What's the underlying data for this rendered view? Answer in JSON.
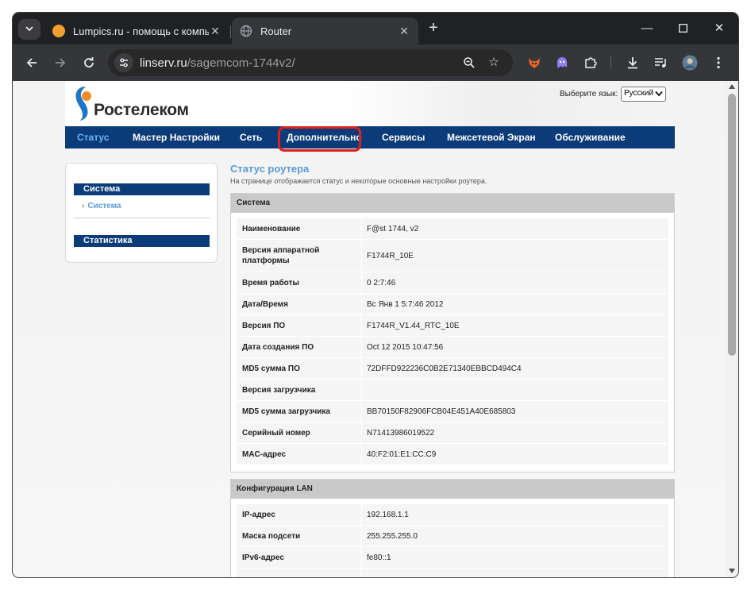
{
  "browser": {
    "tabs": [
      {
        "title": "Lumpics.ru - помощь с компь",
        "active": false,
        "favicon_color": "#f0a030"
      },
      {
        "title": "Router",
        "active": true,
        "favicon_color": "#9aa0a6"
      }
    ],
    "address": {
      "host": "linserv.ru",
      "path": "/sagemcom-1744v2/"
    },
    "icons": {
      "tab_search": "chevron-down-icon",
      "new_tab": "plus-icon",
      "back": "arrow-left-icon",
      "forward": "arrow-right-icon",
      "reload": "reload-icon",
      "site_info": "tune-icon",
      "zoom": "zoom-icon",
      "bookmark": "star-icon",
      "downloads": "download-icon",
      "media": "media-queue-icon",
      "menu": "kebab-menu-icon"
    }
  },
  "router_page": {
    "brand": {
      "name": "Ростелеком",
      "colors": {
        "blue": "#1d75c9",
        "orange": "#f28c28"
      }
    },
    "language": {
      "label": "Выберите язык:",
      "selected": "Русский"
    },
    "nav": [
      {
        "label": "Статус",
        "current": true
      },
      {
        "label": "Мастер Настройки",
        "current": false
      },
      {
        "label": "Сеть",
        "current": false
      },
      {
        "label": "Дополнительно",
        "current": false,
        "highlighted": true
      },
      {
        "label": "Сервисы",
        "current": false
      },
      {
        "label": "Межсетевой Экран",
        "current": false
      },
      {
        "label": "Обслуживание",
        "current": false
      }
    ],
    "sidebar": {
      "groups": [
        {
          "title": "Система",
          "items": [
            "Система"
          ]
        },
        {
          "title": "Статистика",
          "items": []
        }
      ]
    },
    "content": {
      "title": "Статус роутера",
      "description": "На странице отображается статус и некоторые основные настройки роутера.",
      "sections": [
        {
          "title": "Система",
          "rows": [
            {
              "key": "Наименование",
              "value": "F@st 1744, v2"
            },
            {
              "key": "Версия аппаратной платформы",
              "value": "F1744R_10E"
            },
            {
              "key": "Время работы",
              "value": "0 2:7:46"
            },
            {
              "key": "Дата/Время",
              "value": "Вс Янв 1 5:7:46 2012"
            },
            {
              "key": "Версия ПО",
              "value": "F1744R_V1.44_RTC_10E"
            },
            {
              "key": "Дата создания ПО",
              "value": "Oct 12 2015 10:47:56"
            },
            {
              "key": "MD5 сумма ПО",
              "value": "72DFFD922236C0B2E71340EBBCD494C4"
            },
            {
              "key": "Версия загрузчика",
              "value": ""
            },
            {
              "key": "MD5 сумма загрузчика",
              "value": "BB70150F82906FCB04E451A40E685803"
            },
            {
              "key": "Серийный номер",
              "value": "N71413986019522"
            },
            {
              "key": "MAC-адрес",
              "value": "40:F2:01:E1:CC:C9"
            }
          ]
        },
        {
          "title": "Конфигурация LAN",
          "rows": [
            {
              "key": "IP-адрес",
              "value": "192.168.1.1"
            },
            {
              "key": "Маска подсети",
              "value": "255.255.255.0"
            },
            {
              "key": "IPv6-адрес",
              "value": "fe80::1"
            }
          ]
        }
      ]
    },
    "colors": {
      "nav_bg": "#0b3b79",
      "nav_current": "#6ab3f5",
      "highlight": "#e0201c",
      "section_head": "#c9c9c9"
    }
  }
}
